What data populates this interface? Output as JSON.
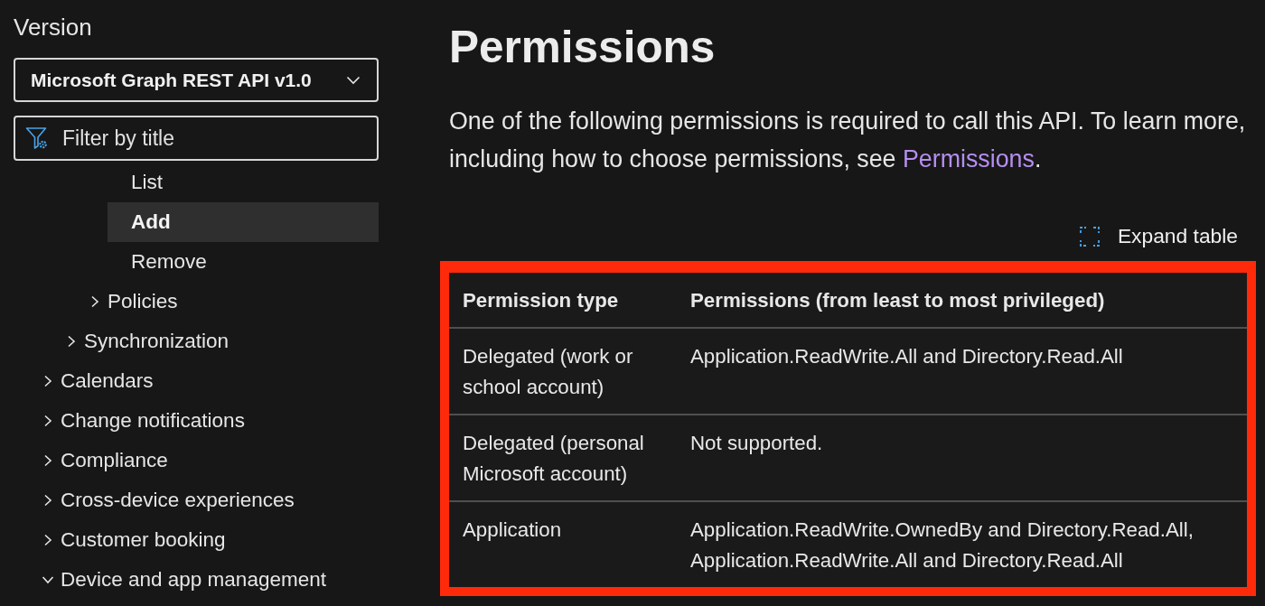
{
  "sidebar": {
    "version_label": "Version",
    "version_select": {
      "value": "Microsoft Graph REST API v1.0"
    },
    "filter": {
      "placeholder": "Filter by title"
    },
    "toc": [
      {
        "children": [
          {
            "children": [
              {
                "children": [
                  {
                    "label": "List",
                    "selected": false
                  },
                  {
                    "label": "Add",
                    "selected": true
                  },
                  {
                    "label": "Remove",
                    "selected": false
                  }
                ]
              },
              {
                "label": "Policies",
                "selected": false,
                "expanded": false
              }
            ]
          },
          {
            "label": "Synchronization",
            "selected": false,
            "expanded": false
          }
        ]
      },
      {
        "label": "Calendars",
        "selected": false,
        "expanded": false
      },
      {
        "label": "Change notifications",
        "selected": false,
        "expanded": false
      },
      {
        "label": "Compliance",
        "selected": false,
        "expanded": false
      },
      {
        "label": "Cross-device experiences",
        "selected": false,
        "expanded": false
      },
      {
        "label": "Customer booking",
        "selected": false,
        "expanded": false
      },
      {
        "label": "Device and app management",
        "selected": false,
        "expanded": true
      }
    ]
  },
  "main": {
    "title": "Permissions",
    "intro": "One of the following permissions is required to call this API. To learn more, including how to choose permissions, see ",
    "intro_link": "Permissions",
    "intro_end": ".",
    "expand_button": "Expand table",
    "table": {
      "highlighted": true,
      "columns": [
        "Permission type",
        "Permissions (from least to most privileged)"
      ],
      "rows": [
        [
          "Delegated (work or school account)",
          "Application.ReadWrite.All and Directory.Read.All"
        ],
        [
          "Delegated (personal Microsoft account)",
          "Not supported."
        ],
        [
          "Application",
          "Application.ReadWrite.OwnedBy and Directory.Read.All, Application.ReadWrite.All and Directory.Read.All"
        ]
      ]
    }
  }
}
